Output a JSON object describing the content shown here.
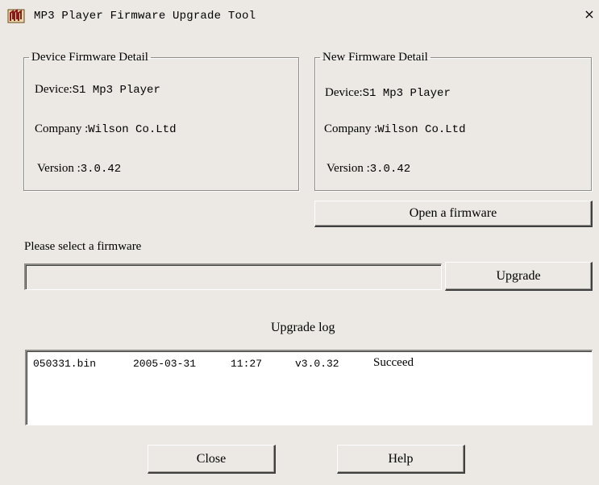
{
  "window": {
    "title": "MP3 Player Firmware Upgrade Tool",
    "icon": "mp3-app-icon",
    "close_glyph": "×"
  },
  "device_firmware": {
    "legend": "Device Firmware Detail",
    "device_label": "Device:",
    "device_value": "S1 Mp3 Player",
    "company_label": "Company :",
    "company_value": "Wilson Co.Ltd",
    "version_label": "Version :",
    "version_value": "3.0.42"
  },
  "new_firmware": {
    "legend": "New Firmware Detail",
    "device_label": "Device:",
    "device_value": "S1 Mp3 Player",
    "company_label": "Company :",
    "company_value": "Wilson Co.Ltd",
    "version_label": "Version :",
    "version_value": "3.0.42"
  },
  "open_firmware_button": "Open a firmware",
  "select_prompt": "Please select a firmware",
  "firmware_path_value": "",
  "upgrade_button": "Upgrade",
  "log_title": "Upgrade log",
  "log_entries": [
    {
      "file": "050331.bin",
      "date": "2005-03-31",
      "time": "11:27",
      "version": "v3.0.32",
      "status": "Succeed"
    }
  ],
  "close_button": "Close",
  "help_button": "Help"
}
